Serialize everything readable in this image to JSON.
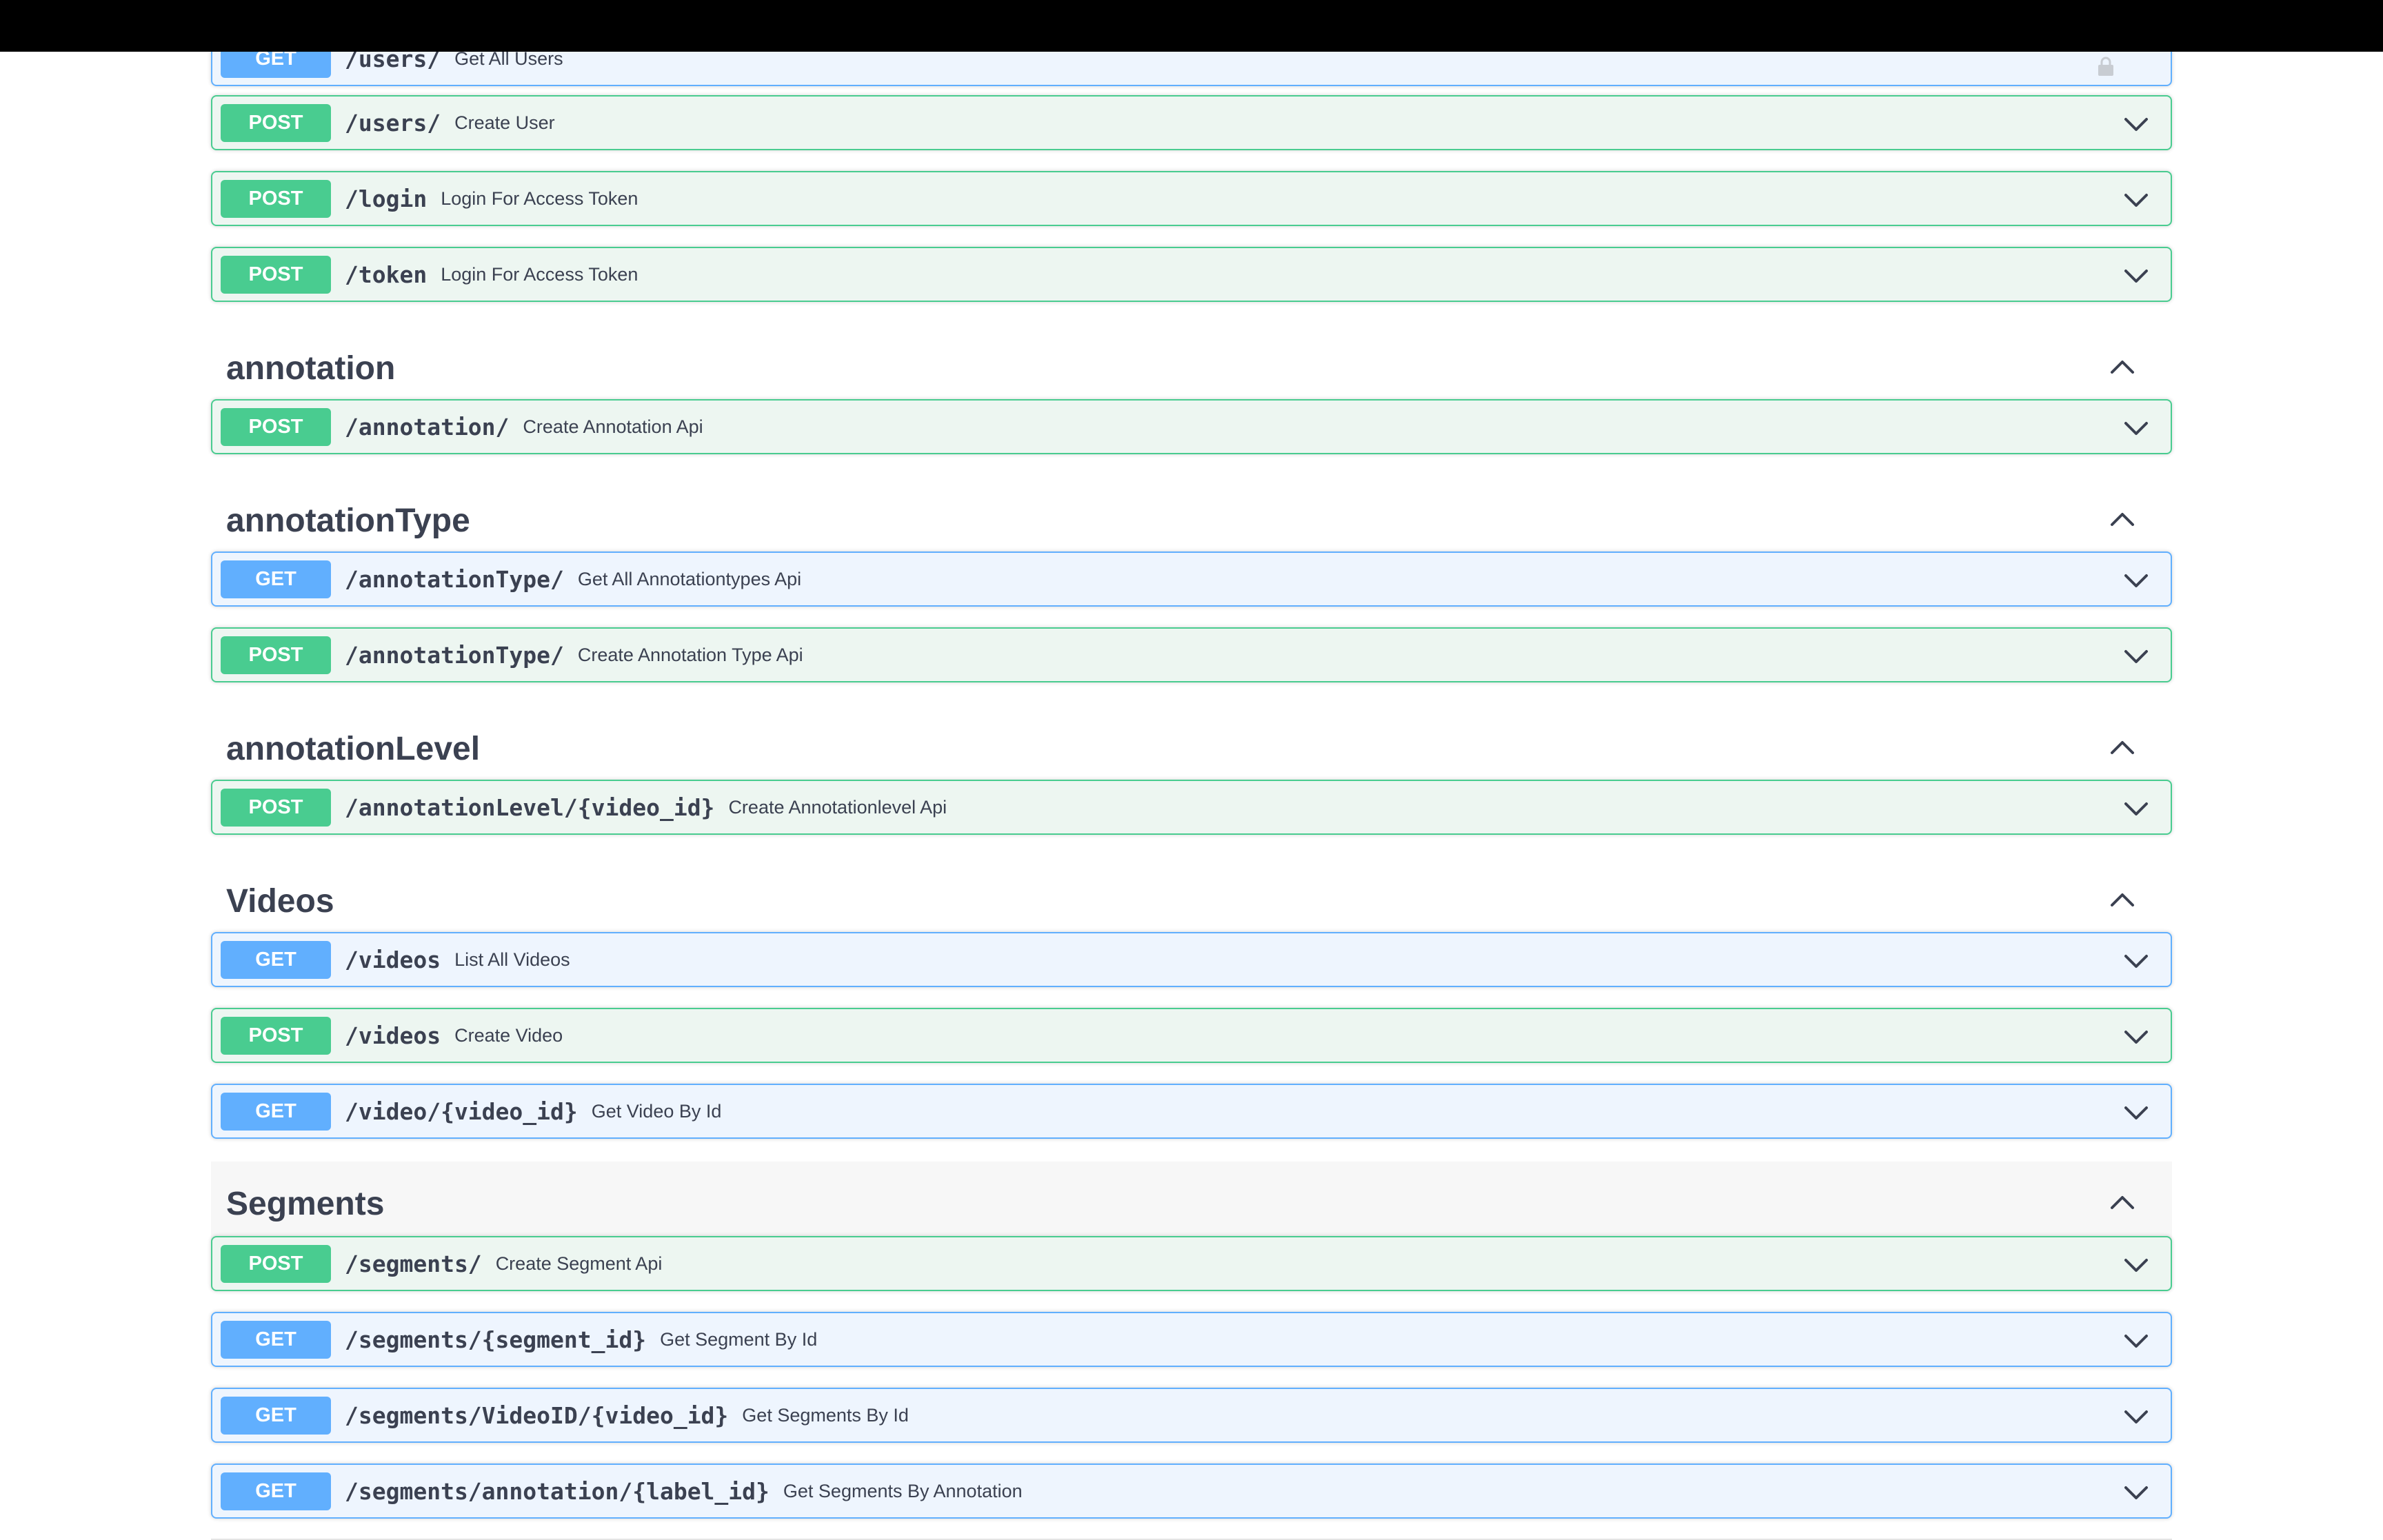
{
  "colors": {
    "post_accent": "#49cc90",
    "post_background": "#edf6f1",
    "get_accent": "#61affe",
    "get_background": "#eef5fe",
    "text": "#3b4151",
    "top_bar": "#000000"
  },
  "partial_top_operation": {
    "method": "GET",
    "path": "/users/",
    "summary": "Get All Users"
  },
  "operations": {
    "users_post": {
      "method": "POST",
      "path": "/users/",
      "summary": "Create User"
    },
    "login_post": {
      "method": "POST",
      "path": "/login",
      "summary": "Login For Access Token"
    },
    "token_post": {
      "method": "POST",
      "path": "/token",
      "summary": "Login For Access Token"
    }
  },
  "tags": {
    "annotation": {
      "title": "annotation",
      "operations": [
        {
          "method": "POST",
          "path": "/annotation/",
          "summary": "Create Annotation Api"
        }
      ]
    },
    "annotationType": {
      "title": "annotationType",
      "operations": [
        {
          "method": "GET",
          "path": "/annotationType/",
          "summary": "Get All Annotationtypes Api"
        },
        {
          "method": "POST",
          "path": "/annotationType/",
          "summary": "Create Annotation Type Api"
        }
      ]
    },
    "annotationLevel": {
      "title": "annotationLevel",
      "operations": [
        {
          "method": "POST",
          "path": "/annotationLevel/{video_id}",
          "summary": "Create Annotationlevel Api"
        }
      ]
    },
    "videos": {
      "title": "Videos",
      "operations": [
        {
          "method": "GET",
          "path": "/videos",
          "summary": "List All Videos"
        },
        {
          "method": "POST",
          "path": "/videos",
          "summary": "Create Video"
        },
        {
          "method": "GET",
          "path": "/video/{video_id}",
          "summary": "Get Video By Id"
        }
      ]
    },
    "segments": {
      "title": "Segments",
      "operations": [
        {
          "method": "POST",
          "path": "/segments/",
          "summary": "Create Segment Api"
        },
        {
          "method": "GET",
          "path": "/segments/{segment_id}",
          "summary": "Get Segment By Id"
        },
        {
          "method": "GET",
          "path": "/segments/VideoID/{video_id}",
          "summary": "Get Segments By Id"
        },
        {
          "method": "GET",
          "path": "/segments/annotation/{label_id}",
          "summary": "Get Segments By Annotation"
        }
      ]
    }
  },
  "icons": {
    "operation_toggle": "chevron-down-icon",
    "tag_toggle": "chevron-up-icon",
    "auth": "lock-icon"
  }
}
